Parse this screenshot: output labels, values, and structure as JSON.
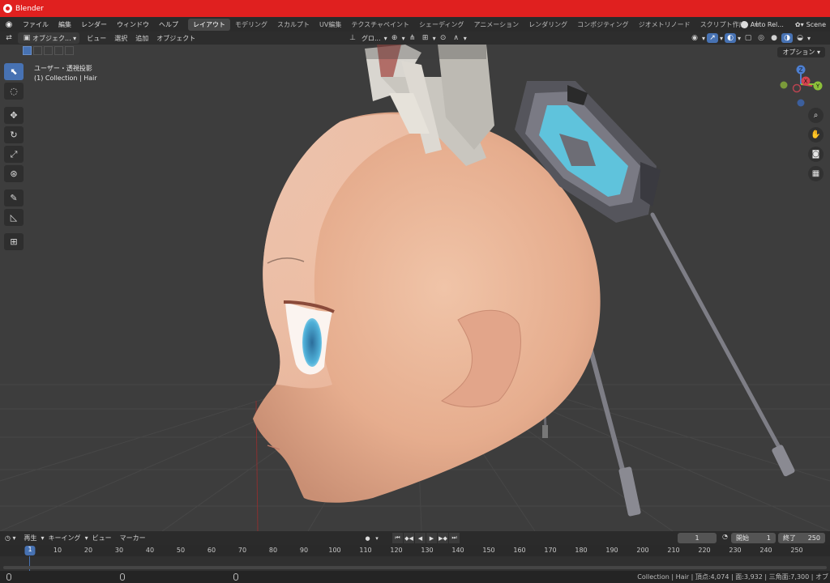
{
  "window": {
    "title": "Blender"
  },
  "menu": {
    "items": [
      "ファイル",
      "編集",
      "レンダー",
      "ウィンドウ",
      "ヘルプ"
    ],
    "workspaces": [
      {
        "label": "レイアウト",
        "active": true
      },
      {
        "label": "モデリング",
        "active": false
      },
      {
        "label": "スカルプト",
        "active": false
      },
      {
        "label": "UV編集",
        "active": false
      },
      {
        "label": "テクスチャペイント",
        "active": false
      },
      {
        "label": "シェーディング",
        "active": false
      },
      {
        "label": "アニメーション",
        "active": false
      },
      {
        "label": "レンダリング",
        "active": false
      },
      {
        "label": "コンポジティング",
        "active": false
      },
      {
        "label": "ジオメトリノード",
        "active": false
      },
      {
        "label": "スクリプト作成",
        "active": false
      }
    ],
    "add_tab": "+",
    "auto_label": "Auto Rel...",
    "scene_label": "Scene"
  },
  "viewport_header": {
    "mode": "オブジェク...",
    "menus": [
      "ビュー",
      "選択",
      "追加",
      "オブジェクト"
    ],
    "transform_orientation": "グロ...",
    "options": "オプション"
  },
  "viewport": {
    "view_name": "ユーザー・透視投影",
    "collection_info": "(1) Collection | Hair"
  },
  "gizmo": {
    "z": "Z",
    "x": "X",
    "y": "Y"
  },
  "timeline": {
    "menus": [
      "再生",
      "キーイング",
      "ビュー",
      "マーカー"
    ],
    "current_frame": "1",
    "start_label": "開始",
    "start_value": "1",
    "end_label": "終了",
    "end_value": "250",
    "ticks": [
      "10",
      "20",
      "30",
      "40",
      "50",
      "60",
      "70",
      "80",
      "90",
      "100",
      "110",
      "120",
      "130",
      "140",
      "150",
      "160",
      "170",
      "180",
      "190",
      "200",
      "210",
      "220",
      "230",
      "240",
      "250"
    ],
    "playhead": "1"
  },
  "status": {
    "stats": "Collection | Hair | 頂点:4,074 | 面:3,932 | 三角面:7,300 | オブ"
  },
  "colors": {
    "accent": "#4772b3",
    "titlebar": "#e0201f",
    "viewport_bg": "#3d3d3d"
  }
}
